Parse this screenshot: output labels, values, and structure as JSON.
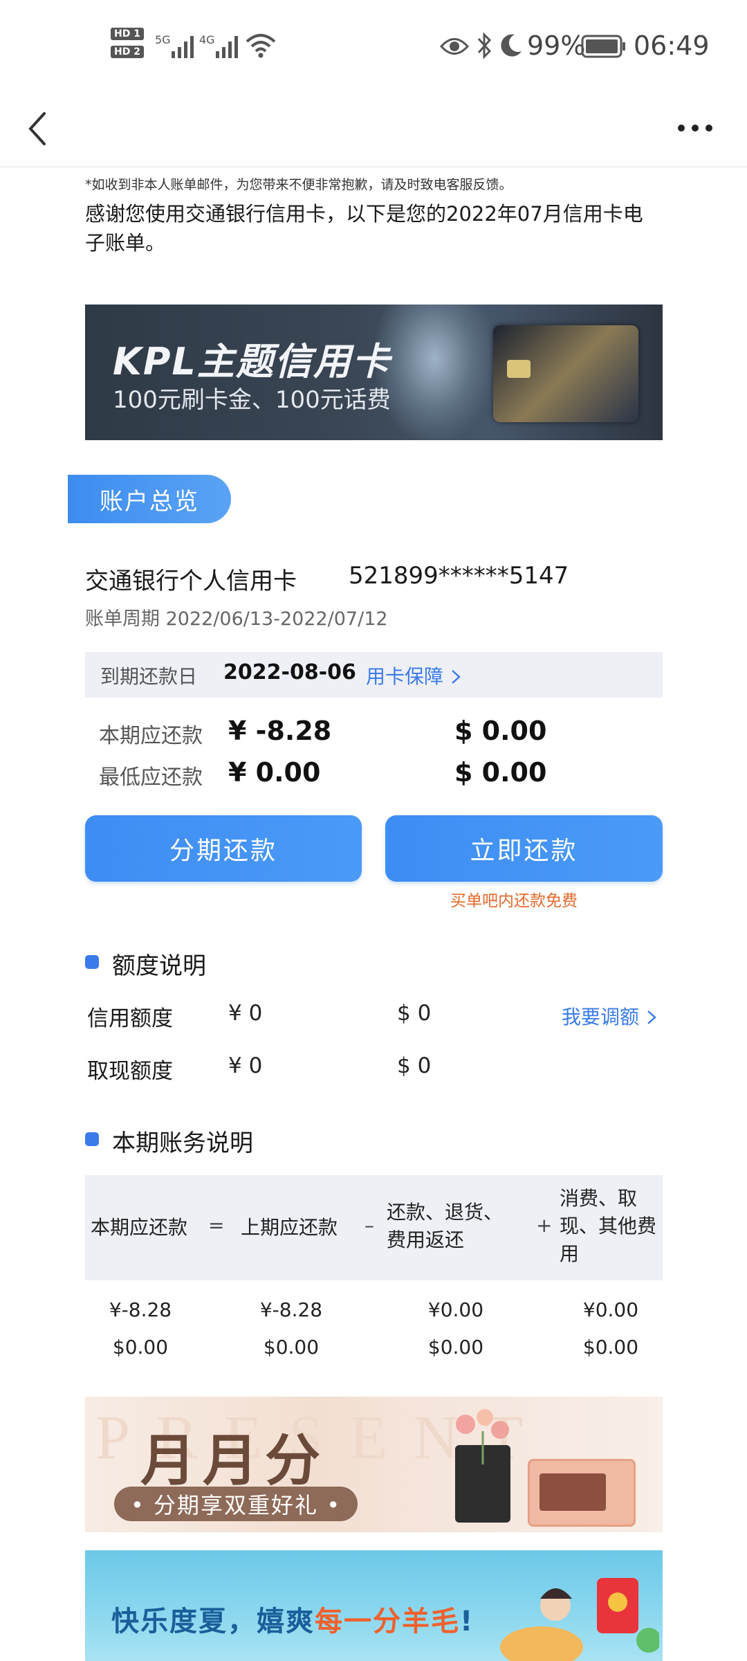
{
  "status_bar": {
    "hd1": "HD 1",
    "hd2": "HD 2",
    "net1": "5G",
    "net2": "4G",
    "battery": "99%",
    "time": "06:49"
  },
  "notice": "*如收到非本人账单邮件，为您带来不便非常抱歉，请及时致电客服反馈。",
  "intro": "感谢您使用交通银行信用卡，以下是您的2022年07月信用卡电子账单。",
  "kpl_banner": {
    "title": "KPL主题信用卡",
    "subtitle": "100元刷卡金、100元话费"
  },
  "overview": {
    "section_label": "账户总览",
    "card_name": "交通银行个人信用卡",
    "card_number": "521899******5147",
    "period": "账单周期 2022/06/13-2022/07/12",
    "due_label": "到期还款日",
    "due_date": "2022-08-06",
    "guard_link": "用卡保障",
    "rows": [
      {
        "label": "本期应还款",
        "cny": "¥ -8.28",
        "usd": "$ 0.00"
      },
      {
        "label": "最低应还款",
        "cny": "¥ 0.00",
        "usd": "$ 0.00"
      }
    ],
    "installment_button": "分期还款",
    "pay_button": "立即还款",
    "free_note": "买单吧内还款免费"
  },
  "limits": {
    "title": "额度说明",
    "rows": [
      {
        "label": "信用额度",
        "cny": "¥ 0",
        "usd": "$ 0"
      },
      {
        "label": "取现额度",
        "cny": "¥ 0",
        "usd": "$ 0"
      }
    ],
    "adjust_link": "我要调额"
  },
  "statement": {
    "title": "本期账务说明",
    "headers": [
      "本期应还款",
      "上期应还款",
      "还款、退货、费用返还",
      "消费、取现、其他费用"
    ],
    "header_lines": {
      "h3a": "还款、退货、",
      "h3b": "费用返还",
      "h4a": "消费、取",
      "h4b": "现、其他费",
      "h4c": "用"
    },
    "operators": [
      "=",
      "–",
      "+"
    ],
    "rows": [
      [
        "¥-8.28",
        "¥-8.28",
        "¥0.00",
        "¥0.00"
      ],
      [
        "$0.00",
        "$0.00",
        "$0.00",
        "$0.00"
      ]
    ]
  },
  "present_banner": {
    "bg_text": "PRESENT",
    "big": "月月分",
    "pill": "• 分期享双重好礼 •"
  },
  "summer_banner": {
    "part1": "快乐度夏，嬉爽",
    "part2": "每一分羊毛",
    "part3": "!"
  },
  "colors": {
    "accent": "#3b7be9",
    "button": "#4292f5",
    "warning": "#e2692a",
    "table_head_bg": "#eef0f6"
  }
}
